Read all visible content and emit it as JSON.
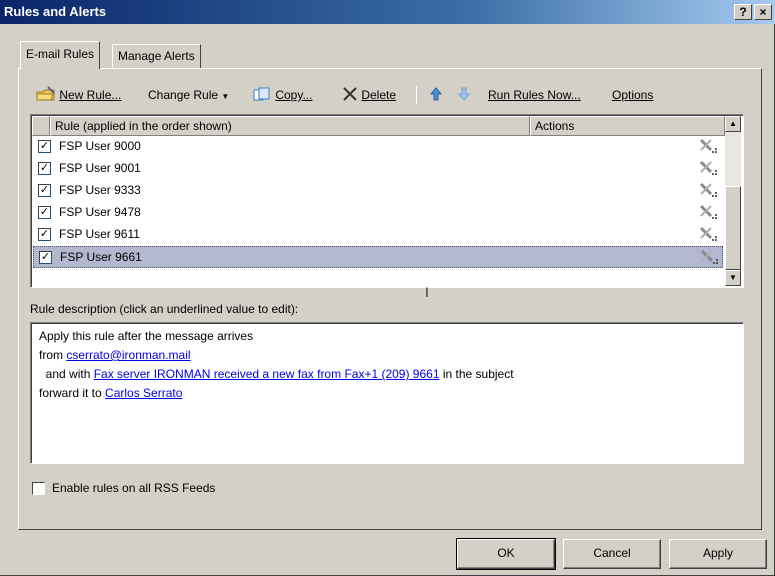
{
  "window": {
    "title": "Rules and Alerts",
    "help_label": "?",
    "close_label": "×"
  },
  "tabs": [
    {
      "label": "E-mail Rules"
    },
    {
      "label": "Manage Alerts"
    }
  ],
  "toolbar": {
    "new_rule": "New Rule...",
    "change_rule": "Change Rule",
    "copy": "Copy...",
    "delete": "Delete",
    "run_rules_now": "Run Rules Now...",
    "options": "Options"
  },
  "rules_list": {
    "col_rule": "Rule (applied in the order shown)",
    "col_actions": "Actions",
    "rows": [
      {
        "name": "FSP User 9000",
        "checked": true
      },
      {
        "name": "FSP User 9001",
        "checked": true
      },
      {
        "name": "FSP User 9333",
        "checked": true
      },
      {
        "name": "FSP User 9478",
        "checked": true
      },
      {
        "name": "FSP User 9611",
        "checked": true
      },
      {
        "name": "FSP User 9661",
        "checked": true,
        "selected": true
      }
    ]
  },
  "description": {
    "label": "Rule description (click an underlined value to edit):",
    "line1": "Apply this rule after the message arrives",
    "line2_prefix": "from ",
    "line2_link": "cserrato@ironman.mail",
    "line3_prefix": "  and with ",
    "line3_link": "Fax server IRONMAN received a new fax from Fax+1 (209) 9661",
    "line3_suffix": " in the subject",
    "line4_prefix": "forward it to ",
    "line4_link": "Carlos Serrato"
  },
  "rss": {
    "label": "Enable rules on all RSS Feeds",
    "checked": false
  },
  "buttons": {
    "ok": "OK",
    "cancel": "Cancel",
    "apply": "Apply"
  },
  "colors": {
    "selected_row": "#b3b8d0",
    "link": "#0000ee",
    "title_start": "#0a246a"
  }
}
